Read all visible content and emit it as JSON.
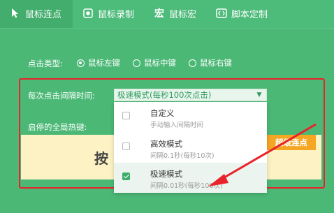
{
  "tabs": [
    {
      "label": "鼠标连点",
      "icon": "cursor-icon",
      "active": true
    },
    {
      "label": "鼠标录制",
      "icon": "record-icon",
      "active": false
    },
    {
      "label": "鼠标宏",
      "icon": "macro-icon",
      "active": false
    },
    {
      "label": "脚本定制",
      "icon": "script-icon",
      "active": false
    }
  ],
  "click_type": {
    "label": "点击类型:",
    "options": [
      "鼠标左键",
      "鼠标中键",
      "鼠标右键"
    ],
    "selected": "鼠标左键"
  },
  "interval": {
    "label": "每次点击间隔时间:",
    "value": "极速模式(每秒100次点击)"
  },
  "hotkey": {
    "label": "启停的全局热键:"
  },
  "banner": {
    "big_text": "按",
    "button_label": "超级连点"
  },
  "dropdown": {
    "options": [
      {
        "title": "自定义",
        "subtitle": "手动输入间隔时间",
        "checked": false
      },
      {
        "title": "高效模式",
        "subtitle": "间隔0.1秒(每秒10次)",
        "checked": false
      },
      {
        "title": "极速模式",
        "subtitle": "间隔0.01秒(每秒100次)",
        "checked": true
      }
    ]
  },
  "colors": {
    "background": "#4bb876",
    "highlight": "#e8232b",
    "accent": "#f5a623"
  }
}
